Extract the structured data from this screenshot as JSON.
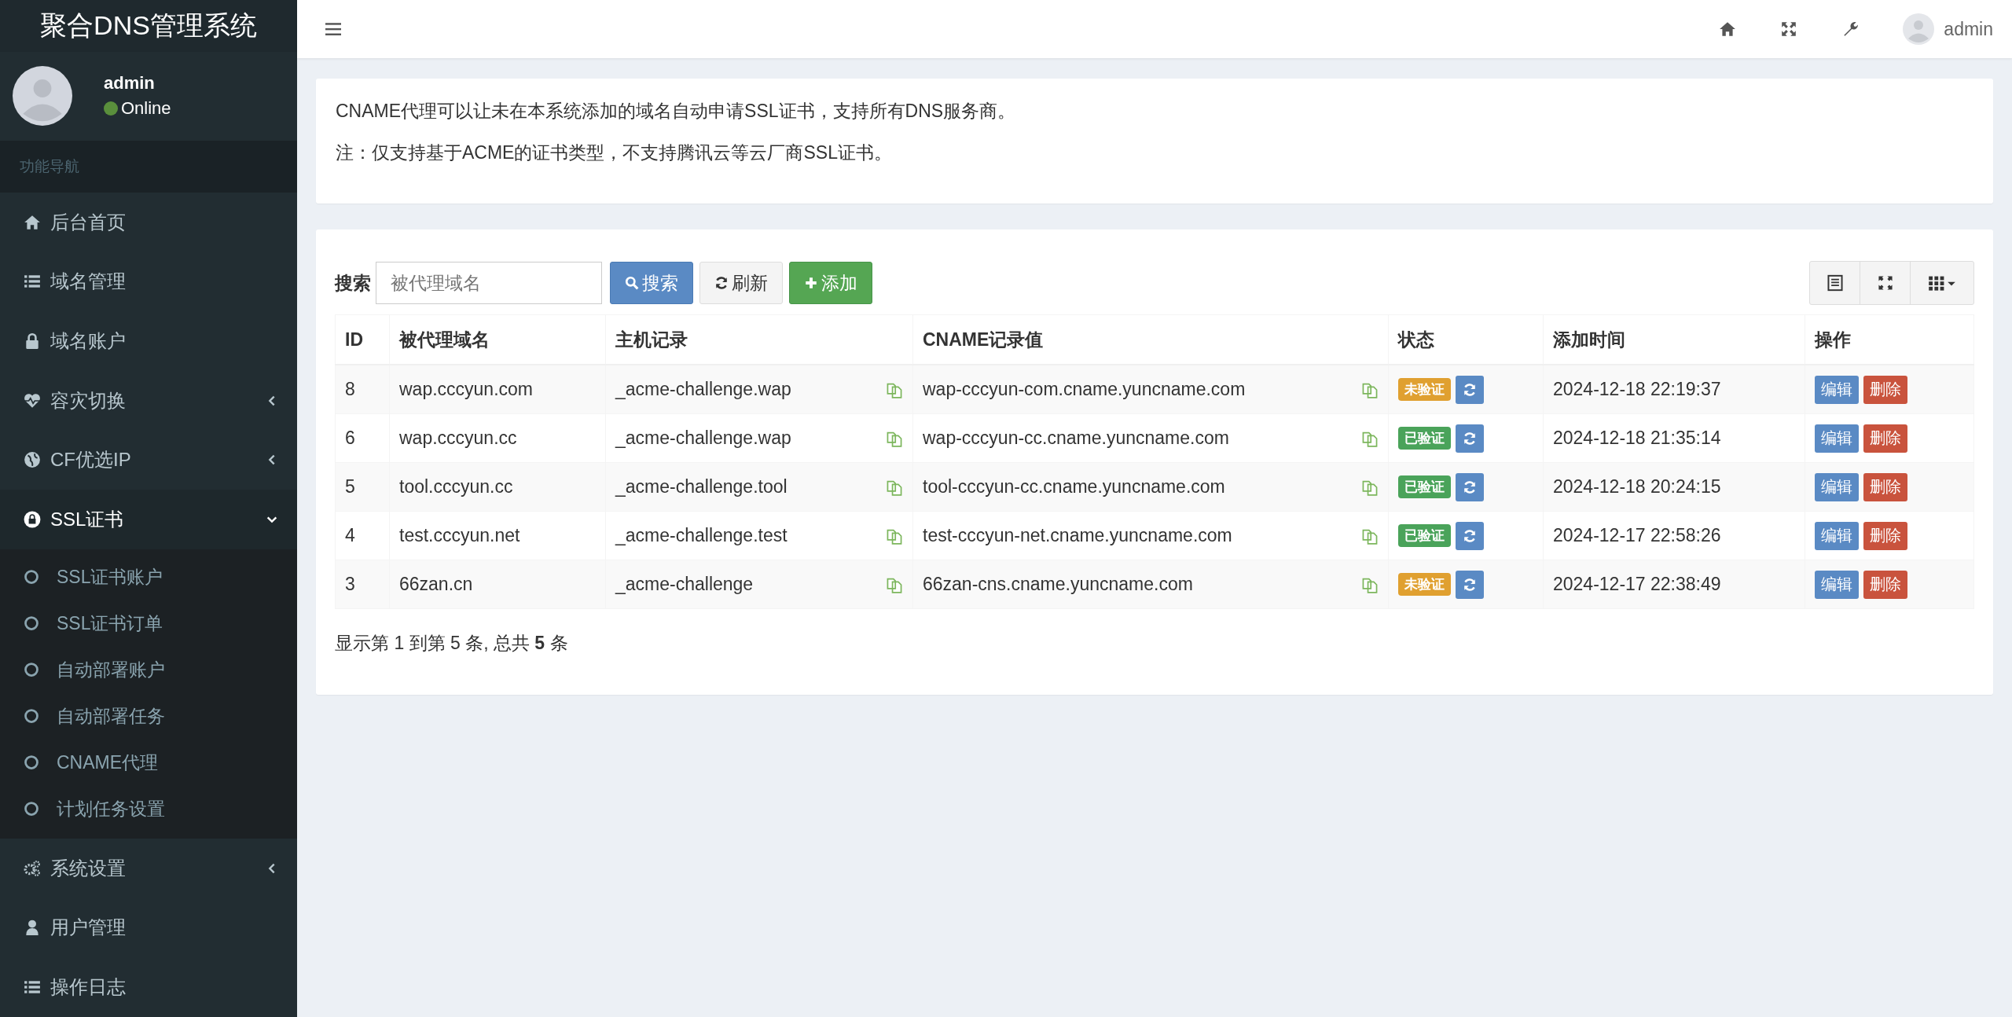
{
  "sidebar": {
    "logo": "聚合DNS管理系统",
    "user": {
      "name": "admin",
      "status": "Online"
    },
    "nav_header": "功能导航",
    "items": [
      {
        "label": "后台首页",
        "kind": "home"
      },
      {
        "label": "域名管理",
        "kind": "list"
      },
      {
        "label": "域名账户",
        "kind": "lock"
      },
      {
        "label": "容灾切换",
        "kind": "heartbeat",
        "expanded": false
      },
      {
        "label": "CF优选IP",
        "kind": "globe",
        "expanded": false
      },
      {
        "label": "SSL证书",
        "kind": "padlock",
        "expanded": true,
        "children": [
          {
            "label": "SSL证书账户"
          },
          {
            "label": "SSL证书订单"
          },
          {
            "label": "自动部署账户"
          },
          {
            "label": "自动部署任务"
          },
          {
            "label": "CNAME代理"
          },
          {
            "label": "计划任务设置"
          }
        ]
      },
      {
        "label": "系统设置",
        "kind": "gears",
        "expanded": false
      },
      {
        "label": "用户管理",
        "kind": "user"
      },
      {
        "label": "操作日志",
        "kind": "list"
      }
    ]
  },
  "topbar": {
    "user": "admin"
  },
  "notice": [
    "CNAME代理可以让未在本系统添加的域名自动申请SSL证书，支持所有DNS服务商。",
    "注：仅支持基于ACME的证书类型，不支持腾讯云等云厂商SSL证书。"
  ],
  "toolbar": {
    "search_label": "搜索",
    "search_placeholder": "被代理域名",
    "search_button": "搜索",
    "refresh_button": "刷新",
    "add_button": "添加"
  },
  "table": {
    "columns": [
      "ID",
      "被代理域名",
      "主机记录",
      "CNAME记录值",
      "状态",
      "添加时间",
      "操作"
    ],
    "rows": [
      {
        "id": "8",
        "domain": "wap.cccyun.com",
        "host": "_acme-challenge.wap",
        "cname": "wap-cccyun-com.cname.yuncname.com",
        "verified": false,
        "status": "未验证",
        "time": "2024-12-18 22:19:37",
        "edit": "编辑",
        "delete": "删除"
      },
      {
        "id": "6",
        "domain": "wap.cccyun.cc",
        "host": "_acme-challenge.wap",
        "cname": "wap-cccyun-cc.cname.yuncname.com",
        "verified": true,
        "status": "已验证",
        "time": "2024-12-18 21:35:14",
        "edit": "编辑",
        "delete": "删除"
      },
      {
        "id": "5",
        "domain": "tool.cccyun.cc",
        "host": "_acme-challenge.tool",
        "cname": "tool-cccyun-cc.cname.yuncname.com",
        "verified": true,
        "status": "已验证",
        "time": "2024-12-18 20:24:15",
        "edit": "编辑",
        "delete": "删除"
      },
      {
        "id": "4",
        "domain": "test.cccyun.net",
        "host": "_acme-challenge.test",
        "cname": "test-cccyun-net.cname.yuncname.com",
        "verified": true,
        "status": "已验证",
        "time": "2024-12-17 22:58:26",
        "edit": "编辑",
        "delete": "删除"
      },
      {
        "id": "3",
        "domain": "66zan.cn",
        "host": "_acme-challenge",
        "cname": "66zan-cns.cname.yuncname.com",
        "verified": false,
        "status": "未验证",
        "time": "2024-12-17 22:38:49",
        "edit": "编辑",
        "delete": "删除"
      }
    ]
  },
  "pagination_info": "显示第 1 到第 5 条, 总共 **5** 条"
}
